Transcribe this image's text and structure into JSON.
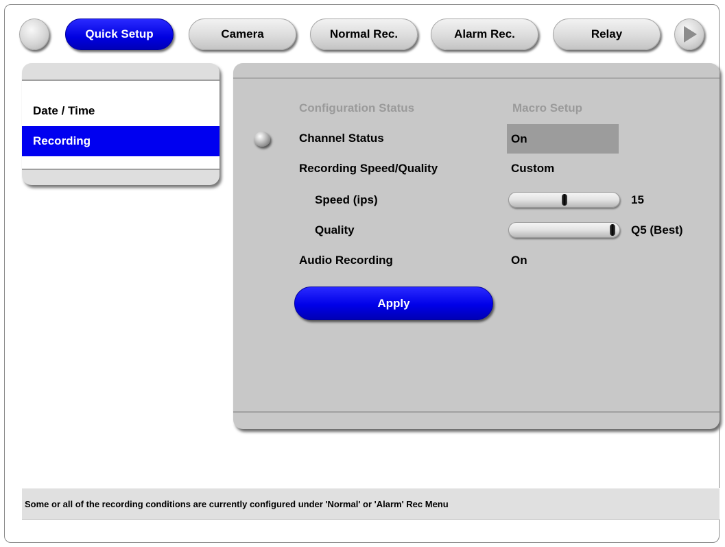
{
  "tabs": [
    {
      "label": "Quick Setup",
      "active": true
    },
    {
      "label": "Camera",
      "active": false
    },
    {
      "label": "Normal Rec.",
      "active": false
    },
    {
      "label": "Alarm Rec.",
      "active": false
    },
    {
      "label": "Relay",
      "active": false
    }
  ],
  "left_menu": {
    "items": [
      {
        "label": "Date / Time",
        "selected": false
      },
      {
        "label": "Recording",
        "selected": true
      }
    ]
  },
  "main": {
    "header_left": "Configuration Status",
    "header_right": "Macro Setup",
    "channel_status": {
      "label": "Channel Status",
      "value": "On"
    },
    "recording_speed_quality": {
      "label": "Recording Speed/Quality",
      "value": "Custom"
    },
    "speed": {
      "label": "Speed (ips)",
      "value": "15",
      "slider_fraction": 0.5
    },
    "quality": {
      "label": "Quality",
      "value": "Q5 (Best)",
      "slider_fraction": 1.0
    },
    "audio_recording": {
      "label": "Audio Recording",
      "value": "On"
    },
    "apply_label": "Apply"
  },
  "status_bar": {
    "message": "Some or all of the recording conditions are currently configured under 'Normal' or 'Alarm' Rec Menu"
  },
  "colors": {
    "accent_blue": "#0000f0",
    "panel_gray": "#c8c8c8",
    "value_box_gray": "#9c9c9c"
  },
  "icons": {
    "left_round_button": "blank-round-button",
    "right_round_button": "play-arrow-icon",
    "row_cursor": "ball-cursor-icon"
  }
}
